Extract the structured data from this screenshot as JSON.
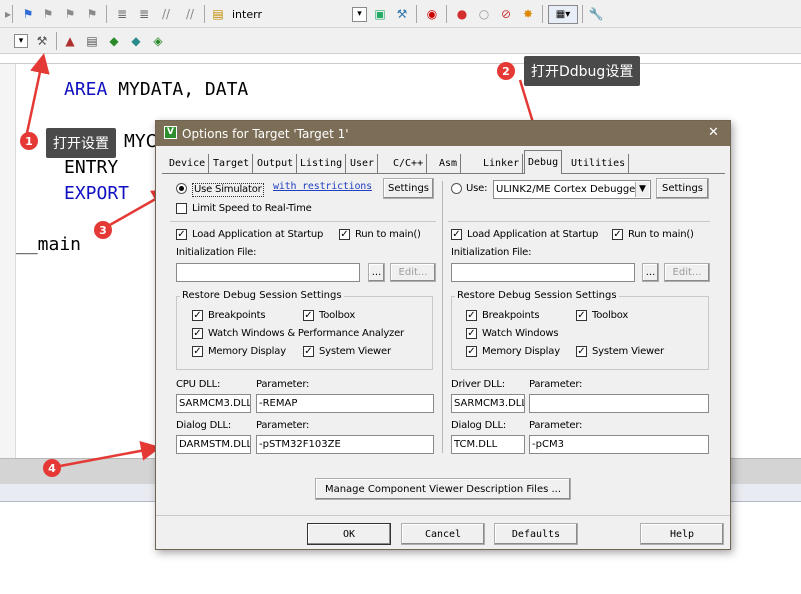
{
  "toolbar": {
    "target_input": "interr"
  },
  "code": {
    "line1_kw": "AREA",
    "line1_rest": " MYDATA, DATA",
    "line2_partial": "MYC",
    "line3": "ENTRY",
    "line4": "EXPORT",
    "line5": "__main"
  },
  "annotations": {
    "badge1": "1",
    "badge2": "2",
    "badge3": "3",
    "badge4": "4",
    "callout1": "打开设置",
    "callout2": "打开Ddbug设置",
    "accent": "#e53935"
  },
  "dialog": {
    "title": "Options for Target 'Target 1'",
    "close": "✕",
    "tabs": [
      "Device",
      "Target",
      "Output",
      "Listing",
      "User",
      "C/C++",
      "Asm",
      "Linker",
      "Debug",
      "Utilities"
    ],
    "active_tab": "Debug",
    "left": {
      "use_simulator": "Use Simulator",
      "with_restrictions": "with restrictions",
      "settings": "Settings",
      "limit_speed": "Limit Speed to Real-Time",
      "load_app": "Load Application at Startup",
      "run_to_main": "Run to main()",
      "init_file": "Initialization File:",
      "browse": "...",
      "edit": "Edit...",
      "restore_group": "Restore Debug Session Settings",
      "breakpoints": "Breakpoints",
      "toolbox": "Toolbox",
      "watch_windows": "Watch Windows & Performance Analyzer",
      "memory_display": "Memory Display",
      "system_viewer": "System Viewer",
      "cpu_dll_label": "CPU DLL:",
      "parameter_label": "Parameter:",
      "cpu_dll": "SARMCM3.DLL",
      "cpu_param": "-REMAP",
      "dialog_dll_label": "Dialog DLL:",
      "dialog_dll": "DARMSTM.DLL",
      "dialog_param": "-pSTM32F103ZE"
    },
    "right": {
      "use": "Use:",
      "debugger": "ULINK2/ME Cortex Debugger",
      "settings": "Settings",
      "load_app": "Load Application at Startup",
      "run_to_main": "Run to main()",
      "init_file": "Initialization File:",
      "browse": "...",
      "edit": "Edit...",
      "restore_group": "Restore Debug Session Settings",
      "breakpoints": "Breakpoints",
      "toolbox": "Toolbox",
      "watch_windows": "Watch Windows",
      "memory_display": "Memory Display",
      "system_viewer": "System Viewer",
      "driver_dll_label": "Driver DLL:",
      "parameter_label": "Parameter:",
      "driver_dll": "SARMCM3.DLL",
      "driver_param": "",
      "dialog_dll_label": "Dialog DLL:",
      "dialog_dll": "TCM.DLL",
      "dialog_param": "-pCM3"
    },
    "manage_button": "Manage Component Viewer Description Files ...",
    "ok": "OK",
    "cancel": "Cancel",
    "defaults": "Defaults",
    "help": "Help"
  }
}
